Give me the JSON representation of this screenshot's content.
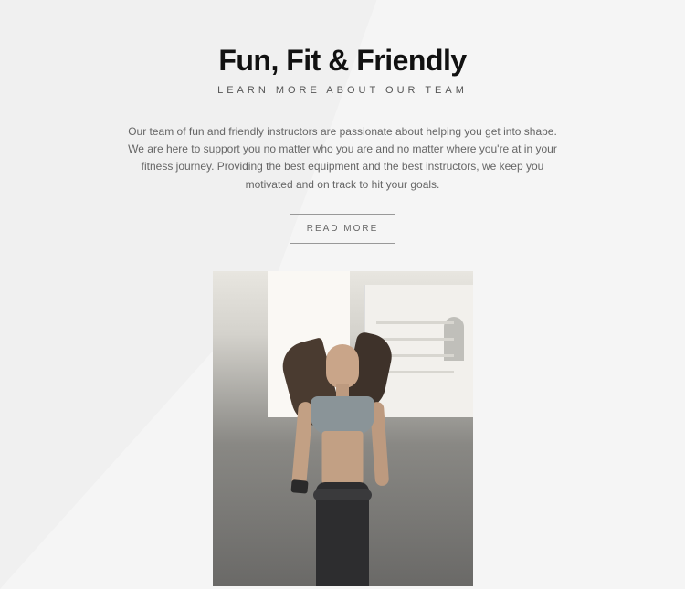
{
  "header": {
    "title": "Fun, Fit & Friendly",
    "subtitle": "LEARN MORE ABOUT OUR TEAM"
  },
  "body": {
    "description": "Our team of fun and friendly instructors are passionate about helping you get into shape. We are here to support you no matter who you are and no matter where you're at in your fitness journey. Providing the best equipment and the best instructors, we keep you motivated and on track to hit your goals."
  },
  "cta": {
    "label": "READ MORE"
  }
}
